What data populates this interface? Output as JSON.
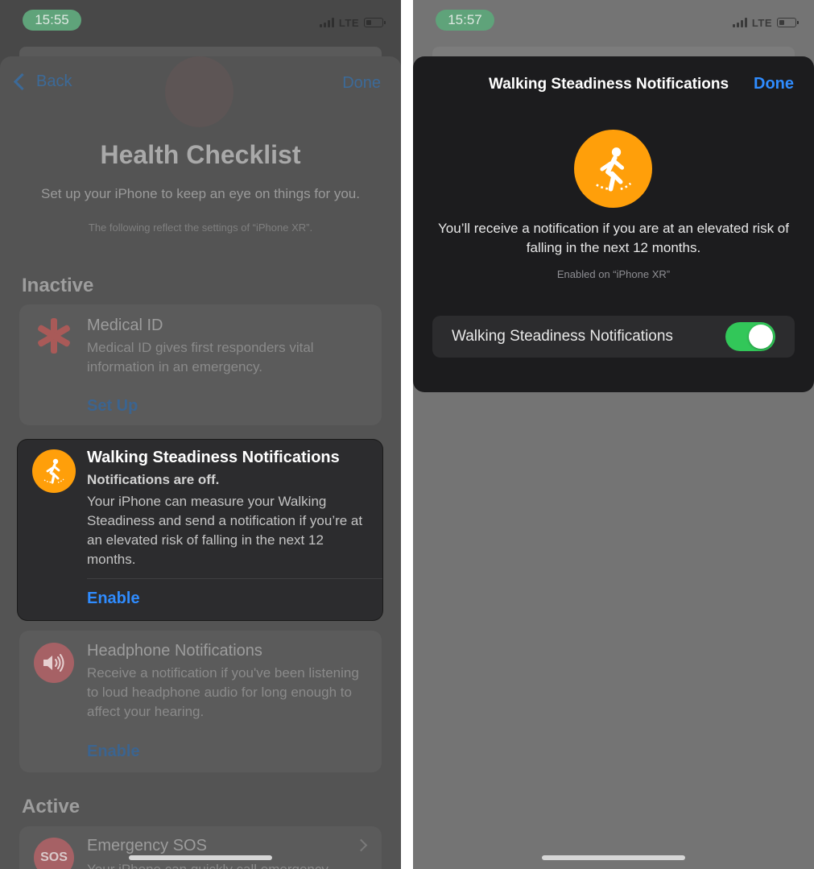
{
  "left": {
    "status": {
      "time": "15:55",
      "network": "LTE"
    },
    "nav": {
      "back": "Back",
      "done": "Done"
    },
    "title": "Health Checklist",
    "subtitle": "Set up your iPhone to keep an eye on things for you.",
    "note": "The following reflect the settings of “iPhone XR”.",
    "inactive_label": "Inactive",
    "medical": {
      "title": "Medical ID",
      "text": "Medical ID gives first responders vital information in an emergency.",
      "action": "Set Up",
      "icon": "asterisk-icon"
    },
    "walking": {
      "title": "Walking Steadiness Notifications",
      "status": "Notifications are off.",
      "text": "Your iPhone can measure your Walking Steadiness and send a notification if you’re at an elevated risk of falling in the next 12 months.",
      "action": "Enable",
      "icon": "walking-figure-icon",
      "icon_color": "#ff9f0a"
    },
    "headphone": {
      "title": "Headphone Notifications",
      "text": "Receive a notification if you've been listening to loud headphone audio for long enough to affect your hearing.",
      "action": "Enable",
      "icon": "speaker-icon"
    },
    "active_label": "Active",
    "sos": {
      "title": "Emergency SOS",
      "badge": "SOS",
      "text": "Your iPhone can quickly call emergency..."
    }
  },
  "right": {
    "status": {
      "time": "15:57",
      "network": "LTE"
    },
    "sheet_title": "Walking Steadiness Notifications",
    "done": "Done",
    "description": "You’ll receive a notification if you are at an elevated risk of falling in the next 12 months.",
    "enabled_note": "Enabled on “iPhone XR”",
    "row_label": "Walking Steadiness Notifications",
    "toggle_on": true,
    "accent": "#2f8cff",
    "toggle_color": "#32c759"
  }
}
